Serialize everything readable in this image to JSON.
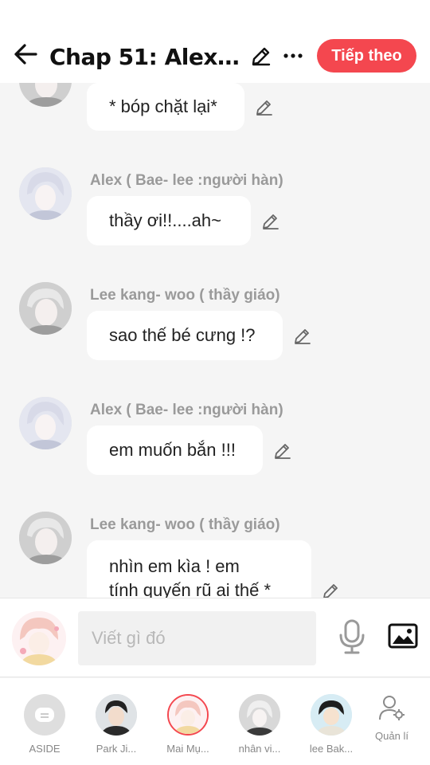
{
  "header": {
    "title": "Chap 51: Alex v...",
    "next_label": "Tiếp theo"
  },
  "messages": [
    {
      "sender": "",
      "text": "* bóp chặt lại*",
      "avatar": "lee-kang-woo"
    },
    {
      "sender": "Alex (  Bae- lee :người hàn)",
      "text": "thầy ơi!!....ah~",
      "avatar": "alex"
    },
    {
      "sender": "Lee kang- woo ( thầy giáo)",
      "text": "sao thế bé cưng !?",
      "avatar": "lee-kang-woo"
    },
    {
      "sender": "Alex (  Bae- lee :người hàn)",
      "text": "em muốn bắn !!!",
      "avatar": "alex"
    },
    {
      "sender": "Lee kang- woo ( thầy giáo)",
      "text_line1": "nhìn em kìa ! em",
      "text_line2": "tính quyến rũ ai thế *",
      "avatar": "lee-kang-woo"
    }
  ],
  "input": {
    "placeholder": "Viết gì đó"
  },
  "characters": [
    {
      "label": "ASIDE"
    },
    {
      "label": "Park Ji..."
    },
    {
      "label": "Mai Mụ..."
    },
    {
      "label": "nhân vi..."
    },
    {
      "label": "lee Bak..."
    }
  ],
  "manage_label": "Quản lí",
  "colors": {
    "accent": "#f4474f",
    "bubble": "#ffffff",
    "background": "#f5f5f5",
    "sender": "#9a9a9a"
  }
}
